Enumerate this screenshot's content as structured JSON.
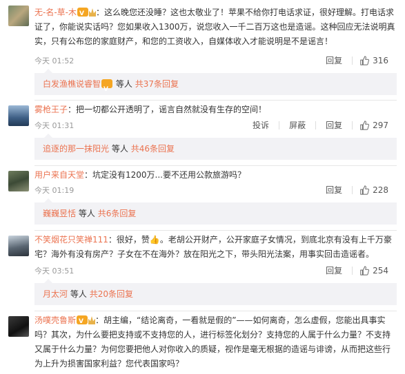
{
  "comments": [
    {
      "username": "无-名-草-木",
      "text": "：这么晚您还没睡？这也太敬业了！苹果不给你打电话求证，很好理解。打电话求证了，你能说实话吗？您如果收入1300万，说您收入一千二百万这也是造谣。这种回应无法说明真实，只有公布您的家庭财产，和您的工资收入，自媒体收入才能说明是不是谣言！",
      "time": "今天 01:52",
      "reply_label": "回复",
      "likes": "316",
      "replies": {
        "name": "白发渔樵说睿智",
        "suffix": "等人",
        "count": "共37条回复"
      }
    },
    {
      "username": "雾枪王子",
      "text": "：把一切都公开透明了，谣言自然就没有生存的空间！",
      "time": "今天 01:31",
      "report_label": "投诉",
      "delete_label": "屏蔽",
      "reply_label": "回复",
      "likes": "297",
      "replies": {
        "name": "追逐的那一抹阳光",
        "suffix": "等人",
        "count": "共46条回复"
      }
    },
    {
      "username": "用户来自天堂",
      "text": "：坑定没有1200万...要不还用公款旅游吗？",
      "time": "今天 01:19",
      "reply_label": "回复",
      "likes": "228",
      "replies": {
        "name": "巍巍昱恬",
        "suffix": "等人",
        "count": "共6条回复"
      }
    },
    {
      "username": "不笑烟花只笑禅111",
      "text": "：很好，赞👍。老胡公开财产，公开家庭子女情况，到底北京有没有上千万豪宅？海外有没有房产？子女在不在海外？放在阳光之下，带头阳光法案，用事实回击造谣者。",
      "time": "今天 03:51",
      "reply_label": "回复",
      "likes": "254",
      "replies": {
        "name": "月太河",
        "suffix": "等人",
        "count": "共20条回复"
      }
    },
    {
      "username": "汤噗壳鲁斯",
      "text": "：胡主编，“结论离奇，一看就是假的”——如何离奇，怎么虚假，您能出具事实吗？其次，为什么要把支持或不支持您的人，进行标签化划分？支持您的人属于什么力量？不支持又属于什么力量？为何您要把他人对你收入的质疑，视作是毫无根据的造谣与诽谤，从而把这些行为上升为损害国家利益？您代表国家吗？"
    }
  ]
}
